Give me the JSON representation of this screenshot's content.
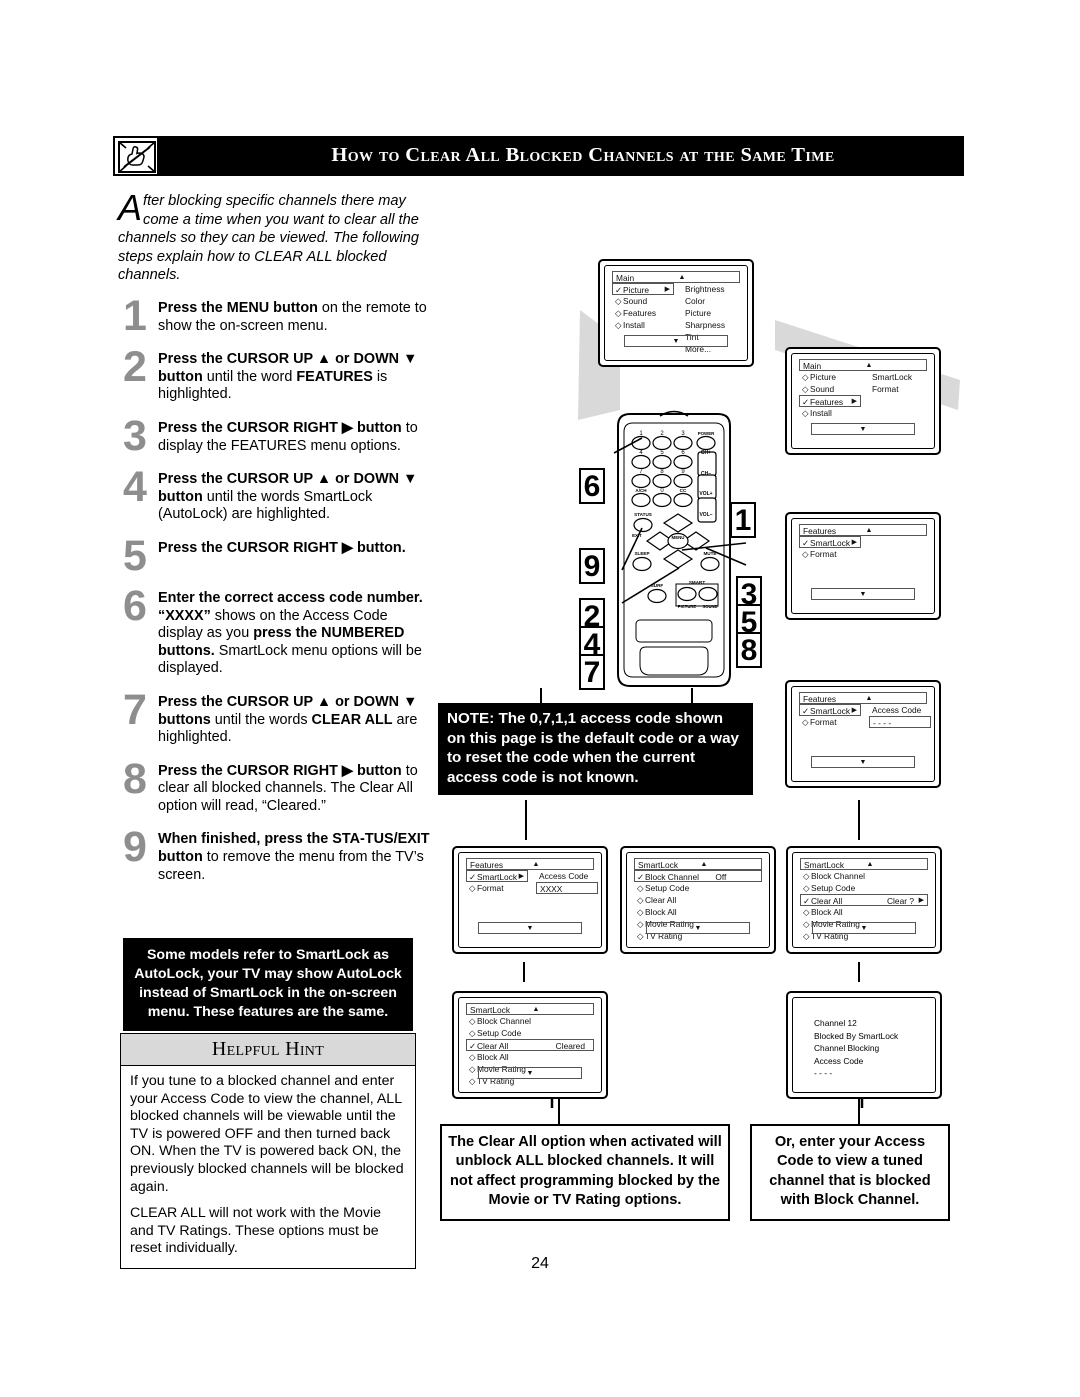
{
  "header": {
    "title": "How to Clear All Blocked Channels at the Same Time",
    "icon": "blocked-hand-tv-icon"
  },
  "intro": {
    "dropcap": "A",
    "text": "fter blocking specific channels there may come a time when you want to clear all the channels so they can be viewed. The following steps explain how to CLEAR ALL blocked channels."
  },
  "steps": [
    {
      "num": "1",
      "html": "<b>Press the MENU button</b> on the remote to show the on-screen menu."
    },
    {
      "num": "2",
      "html": "<b>Press the CURSOR UP ▲ or DOWN ▼ button</b> until the word <b>FEATURES</b> is highlighted."
    },
    {
      "num": "3",
      "html": "<b>Press the CURSOR RIGHT ▶ button</b> to display the FEATURES menu options."
    },
    {
      "num": "4",
      "html": "<b>Press the CURSOR UP ▲ or DOWN ▼ button</b> until the words SmartLock (AutoLock) are highlighted."
    },
    {
      "num": "5",
      "html": "<b>Press the CURSOR RIGHT ▶ button.</b>"
    },
    {
      "num": "6",
      "html": "<b>Enter the correct access code number. “XXXX”</b> shows on the Access Code display as you <b>press the NUMBERED buttons.</b> SmartLock menu options will be displayed."
    },
    {
      "num": "7",
      "html": "<b>Press the CURSOR UP ▲ or DOWN ▼ buttons</b> until the words <b>CLEAR ALL</b> are highlighted."
    },
    {
      "num": "8",
      "html": "<b>Press the CURSOR RIGHT ▶ button</b> to clear all blocked channels. The Clear All option will read, “Cleared.”"
    },
    {
      "num": "9",
      "html": "<b>When finished, press the STA-TUS/EXIT button</b> to remove the menu from the TV’s screen."
    }
  ],
  "smartlock_note": "Some models refer to SmartLock as AutoLock, your TV may show AutoLock instead of SmartLock in the on-screen menu. These features are the same.",
  "hint": {
    "title": "Helpful Hint",
    "paragraphs": [
      "If you tune to a blocked channel and enter your Access Code to view the channel, ALL blocked channels will be viewable until the TV is powered OFF and then turned back ON. When the TV is powered back ON, the previously blocked channels will be blocked again.",
      "CLEAR ALL will not work with the Movie and TV Ratings. These options must be reset individually."
    ]
  },
  "note_box": "NOTE: The 0,7,1,1 access code shown on this page is the default code or a way to reset the code when the current access code is not known.",
  "captions": {
    "clear_all": "The Clear All option when activated will unblock ALL blocked channels. It will not affect programming blocked by the Movie or TV Rating options.",
    "access_code": "Or, enter your Access Code to view a tuned channel that is blocked with Block Channel."
  },
  "remote": {
    "buttons": {
      "r1": [
        "1",
        "2",
        "3",
        "POWER"
      ],
      "r2": [
        "4",
        "5",
        "6",
        "CH+"
      ],
      "r3": [
        "7",
        "8",
        "9",
        "CH–"
      ],
      "r4": [
        "A/CH",
        "0",
        "CC",
        "VOL+"
      ],
      "status": "STATUS",
      "exit": "EXIT",
      "vol_minus": "VOL–",
      "menu": "MENU",
      "sleep": "SLEEP",
      "mute": "MUTE",
      "surf": "SURF",
      "smart": "SMART",
      "picture": "PICTURE",
      "sound": "SOUND"
    },
    "callouts_left": [
      "6",
      "9",
      "2",
      "4",
      "7"
    ],
    "callouts_right": [
      "1",
      "3",
      "5",
      "8"
    ]
  },
  "screens": {
    "main_picture": {
      "title": "Main",
      "up": "▲",
      "down": "▼",
      "left_items": [
        {
          "label": "Picture",
          "mark": "✓",
          "selected": true,
          "arrow": "▶"
        },
        {
          "label": "Sound",
          "mark": "◇",
          "selected": false
        },
        {
          "label": "Features",
          "mark": "◇",
          "selected": false
        },
        {
          "label": "Install",
          "mark": "◇",
          "selected": false
        }
      ],
      "right_items": [
        "Brightness",
        "Color",
        "Picture",
        "Sharpness",
        "Tint",
        "More..."
      ]
    },
    "main_features": {
      "title": "Main",
      "up": "▲",
      "down": "▼",
      "left_items": [
        {
          "label": "Picture",
          "mark": "◇",
          "selected": false
        },
        {
          "label": "Sound",
          "mark": "◇",
          "selected": false
        },
        {
          "label": "Features",
          "mark": "✓",
          "selected": true,
          "arrow": "▶"
        },
        {
          "label": "Install",
          "mark": "◇",
          "selected": false
        }
      ],
      "right_items": [
        "SmartLock",
        "Format"
      ]
    },
    "features_smartlock": {
      "title": "Features",
      "up": "▲",
      "down": "▼",
      "left_items": [
        {
          "label": "SmartLock",
          "mark": "✓",
          "selected": true,
          "arrow": "▶"
        },
        {
          "label": "Format",
          "mark": "◇",
          "selected": false
        }
      ],
      "right_items": []
    },
    "features_accesscode_empty": {
      "title": "Features",
      "up": "▲",
      "down": "▼",
      "left_items": [
        {
          "label": "SmartLock",
          "mark": "✓",
          "selected": true,
          "arrow": "▶"
        },
        {
          "label": "Format",
          "mark": "◇",
          "selected": false
        }
      ],
      "right_label": "Access Code",
      "right_value": "- - - -"
    },
    "features_accesscode_xxxx": {
      "title": "Features",
      "up": "▲",
      "down": "▼",
      "left_items": [
        {
          "label": "SmartLock",
          "mark": "✓",
          "selected": true,
          "arrow": "▶"
        },
        {
          "label": "Format",
          "mark": "◇",
          "selected": false
        }
      ],
      "right_label": "Access Code",
      "right_value": "XXXX"
    },
    "smartlock_block": {
      "title": "SmartLock",
      "up": "▲",
      "down": "▼",
      "items": [
        {
          "label": "Block Channel",
          "mark": "✓",
          "selected": true,
          "value": "Off"
        },
        {
          "label": "Setup Code",
          "mark": "◇",
          "selected": false
        },
        {
          "label": "Clear All",
          "mark": "◇",
          "selected": false
        },
        {
          "label": "Block All",
          "mark": "◇",
          "selected": false
        },
        {
          "label": "Movie Rating",
          "mark": "◇",
          "selected": false
        },
        {
          "label": "TV Rating",
          "mark": "◇",
          "selected": false
        }
      ]
    },
    "smartlock_clear_q": {
      "title": "SmartLock",
      "up": "▲",
      "down": "▼",
      "items": [
        {
          "label": "Block Channel",
          "mark": "◇",
          "selected": false
        },
        {
          "label": "Setup Code",
          "mark": "◇",
          "selected": false
        },
        {
          "label": "Clear All",
          "mark": "✓",
          "selected": true,
          "value": "Clear ?",
          "arrow": "▶"
        },
        {
          "label": "Block All",
          "mark": "◇",
          "selected": false
        },
        {
          "label": "Movie Rating",
          "mark": "◇",
          "selected": false
        },
        {
          "label": "TV Rating",
          "mark": "◇",
          "selected": false
        }
      ]
    },
    "smartlock_cleared": {
      "title": "SmartLock",
      "up": "▲",
      "down": "▼",
      "items": [
        {
          "label": "Block Channel",
          "mark": "◇",
          "selected": false
        },
        {
          "label": "Setup Code",
          "mark": "◇",
          "selected": false
        },
        {
          "label": "Clear All",
          "mark": "✓",
          "selected": true,
          "value": "Cleared"
        },
        {
          "label": "Block All",
          "mark": "◇",
          "selected": false
        },
        {
          "label": "Movie Rating",
          "mark": "◇",
          "selected": false
        },
        {
          "label": "TV Rating",
          "mark": "◇",
          "selected": false
        }
      ]
    },
    "blocked_msg": {
      "lines": [
        "Channel 12",
        "Blocked By SmartLock",
        "Channel Blocking",
        "Access Code",
        "- - - -"
      ]
    }
  },
  "page_number": "24"
}
